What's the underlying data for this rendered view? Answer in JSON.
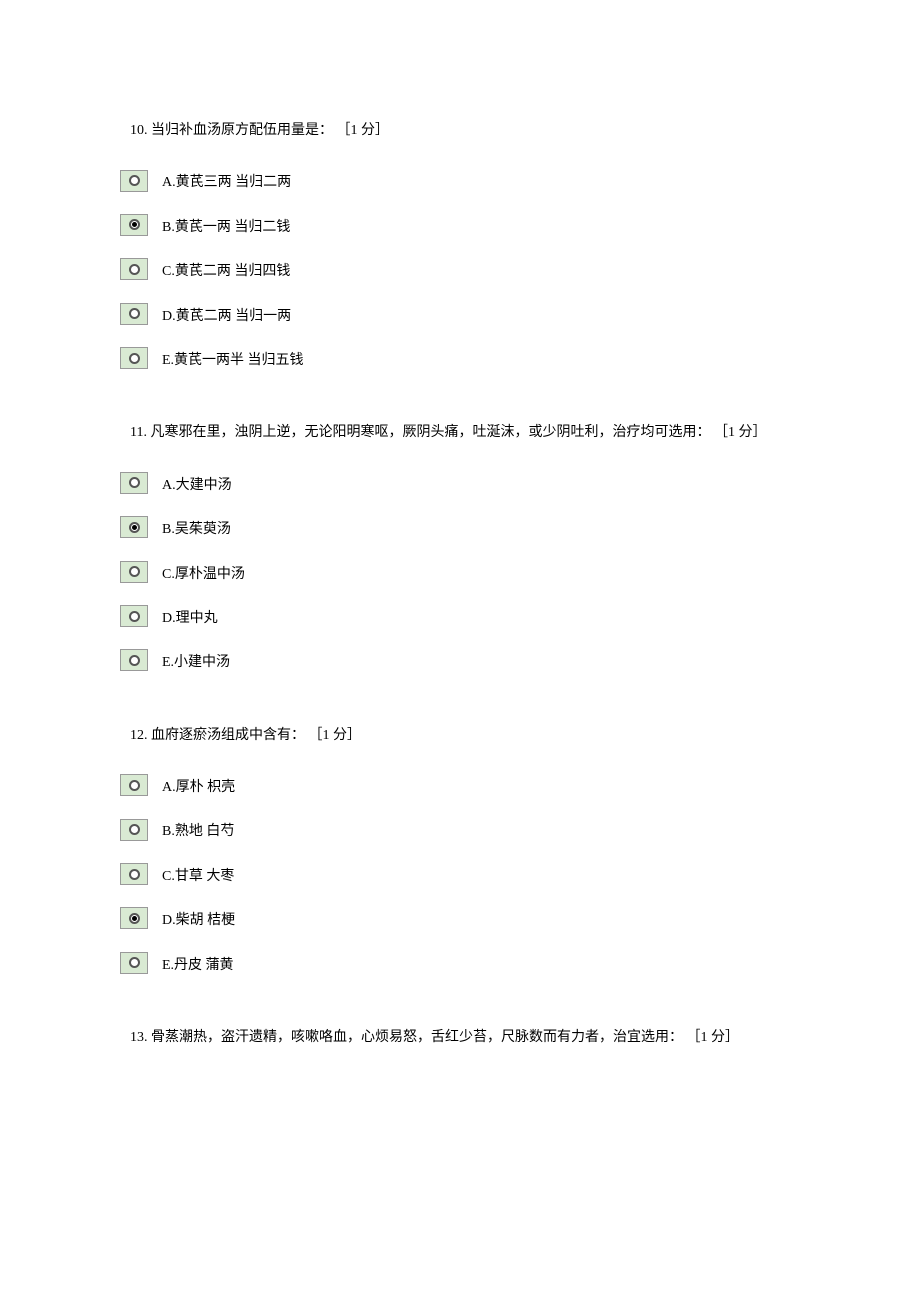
{
  "questions": [
    {
      "number": "10.",
      "text": "当归补血汤原方配伍用量是： ［1 分］",
      "selected": 1,
      "options": [
        "A.黄芪三两 当归二两",
        "B.黄芪一两 当归二钱",
        "C.黄芪二两 当归四钱",
        "D.黄芪二两 当归一两",
        "E.黄芪一两半 当归五钱"
      ]
    },
    {
      "number": "11.",
      "text": "凡寒邪在里，浊阴上逆，无论阳明寒呕，厥阴头痛，吐涎沫，或少阴吐利，治疗均可选用： ［1 分］",
      "selected": 1,
      "options": [
        "A.大建中汤",
        "B.吴茱萸汤",
        "C.厚朴温中汤",
        "D.理中丸",
        "E.小建中汤"
      ]
    },
    {
      "number": "12.",
      "text": "血府逐瘀汤组成中含有： ［1 分］",
      "selected": 3,
      "options": [
        "A.厚朴 枳壳",
        "B.熟地 白芍",
        "C.甘草 大枣",
        "D.柴胡 桔梗",
        "E.丹皮 蒲黄"
      ]
    },
    {
      "number": "13.",
      "text": "骨蒸潮热，盗汗遗精，咳嗽咯血，心烦易怒，舌红少苔，尺脉数而有力者，治宜选用： ［1 分］",
      "selected": -1,
      "options": []
    }
  ]
}
